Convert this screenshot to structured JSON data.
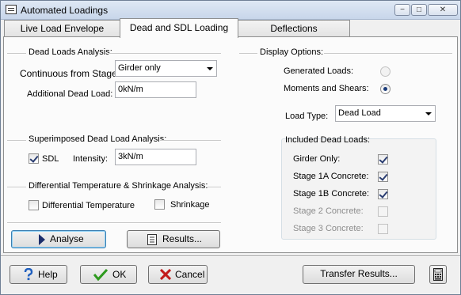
{
  "window": {
    "title": "Automated Loadings",
    "minimize_glyph": "−",
    "maximize_glyph": "□",
    "close_glyph": "✕"
  },
  "tabs": [
    {
      "label": "Live Load Envelope"
    },
    {
      "label": "Dead and SDL Loading"
    },
    {
      "label": "Deflections"
    }
  ],
  "dead_loads": {
    "title": "Dead Loads Analysis:",
    "continuous_label": "Continuous from Stage:",
    "continuous_value": "Girder only",
    "additional_label": "Additional Dead Load:",
    "additional_value": "0kN/m"
  },
  "sdl": {
    "title": "Superimposed Dead Load Analysis:",
    "checkbox_label": "SDL",
    "checked": true,
    "intensity_label": "Intensity:",
    "intensity_value": "3kN/m"
  },
  "diff_temp": {
    "title": "Differential Temperature & Shrinkage Analysis:",
    "temp_label": "Differential Temperature",
    "temp_checked": false,
    "shrink_label": "Shrinkage",
    "shrink_checked": false
  },
  "actions": {
    "analyse_label": "Analyse",
    "results_label": "Results..."
  },
  "display_options": {
    "title": "Display Options:",
    "generated_label": "Generated Loads:",
    "moments_label": "Moments and Shears:",
    "selected": "Moments and Shears",
    "load_type_label": "Load Type:",
    "load_type_value": "Dead Load"
  },
  "included": {
    "title": "Included Dead Loads:",
    "items": [
      {
        "label": "Girder Only:",
        "checked": true,
        "enabled": true
      },
      {
        "label": "Stage 1A Concrete:",
        "checked": true,
        "enabled": true
      },
      {
        "label": "Stage 1B Concrete:",
        "checked": true,
        "enabled": true
      },
      {
        "label": "Stage 2 Concrete:",
        "checked": false,
        "enabled": false
      },
      {
        "label": "Stage 3 Concrete:",
        "checked": false,
        "enabled": false
      }
    ]
  },
  "footer": {
    "help_label": "Help",
    "ok_label": "OK",
    "cancel_label": "Cancel",
    "transfer_label": "Transfer Results..."
  },
  "icons": {
    "help": "question-mark-icon",
    "ok": "check-mark-icon",
    "cancel": "x-mark-icon",
    "analyse": "play-arrow-icon",
    "results": "document-icon",
    "calculator": "calculator-icon"
  },
  "colors": {
    "help_blue": "#1f5fbf",
    "ok_green": "#2e9a1f",
    "cancel_red": "#c21a1a",
    "analyse_navy": "#1b2d6b"
  }
}
